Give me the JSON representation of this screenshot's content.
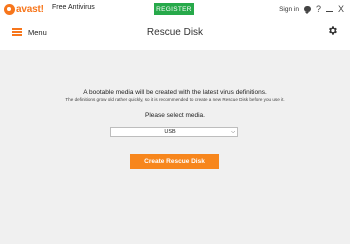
{
  "titlebar": {
    "logo_text": "avast!",
    "product": "Free Antivirus",
    "register_label": "REGISTER",
    "signin_label": "Sign in",
    "help_label": "?",
    "minimize_label": "_",
    "close_label": "X"
  },
  "header": {
    "menu_label": "Menu",
    "title": "Rescue Disk"
  },
  "main": {
    "description": "A bootable media will be created with the latest virus definitions.",
    "note": "The definitions grow old rather quickly, so it is recommended to create a new Rescue Disk before you use it.",
    "select_prompt": "Please select media.",
    "media_selected": "USB",
    "create_button": "Create Rescue Disk"
  },
  "colors": {
    "accent": "#f7761c",
    "register": "#27a94a",
    "content_bg": "#f0f0f0"
  },
  "icons": {
    "logo": "avast-logo-icon",
    "chat": "chat-icon",
    "menu": "hamburger-icon",
    "settings": "gear-icon",
    "dropdown": "chevron-down-icon"
  }
}
